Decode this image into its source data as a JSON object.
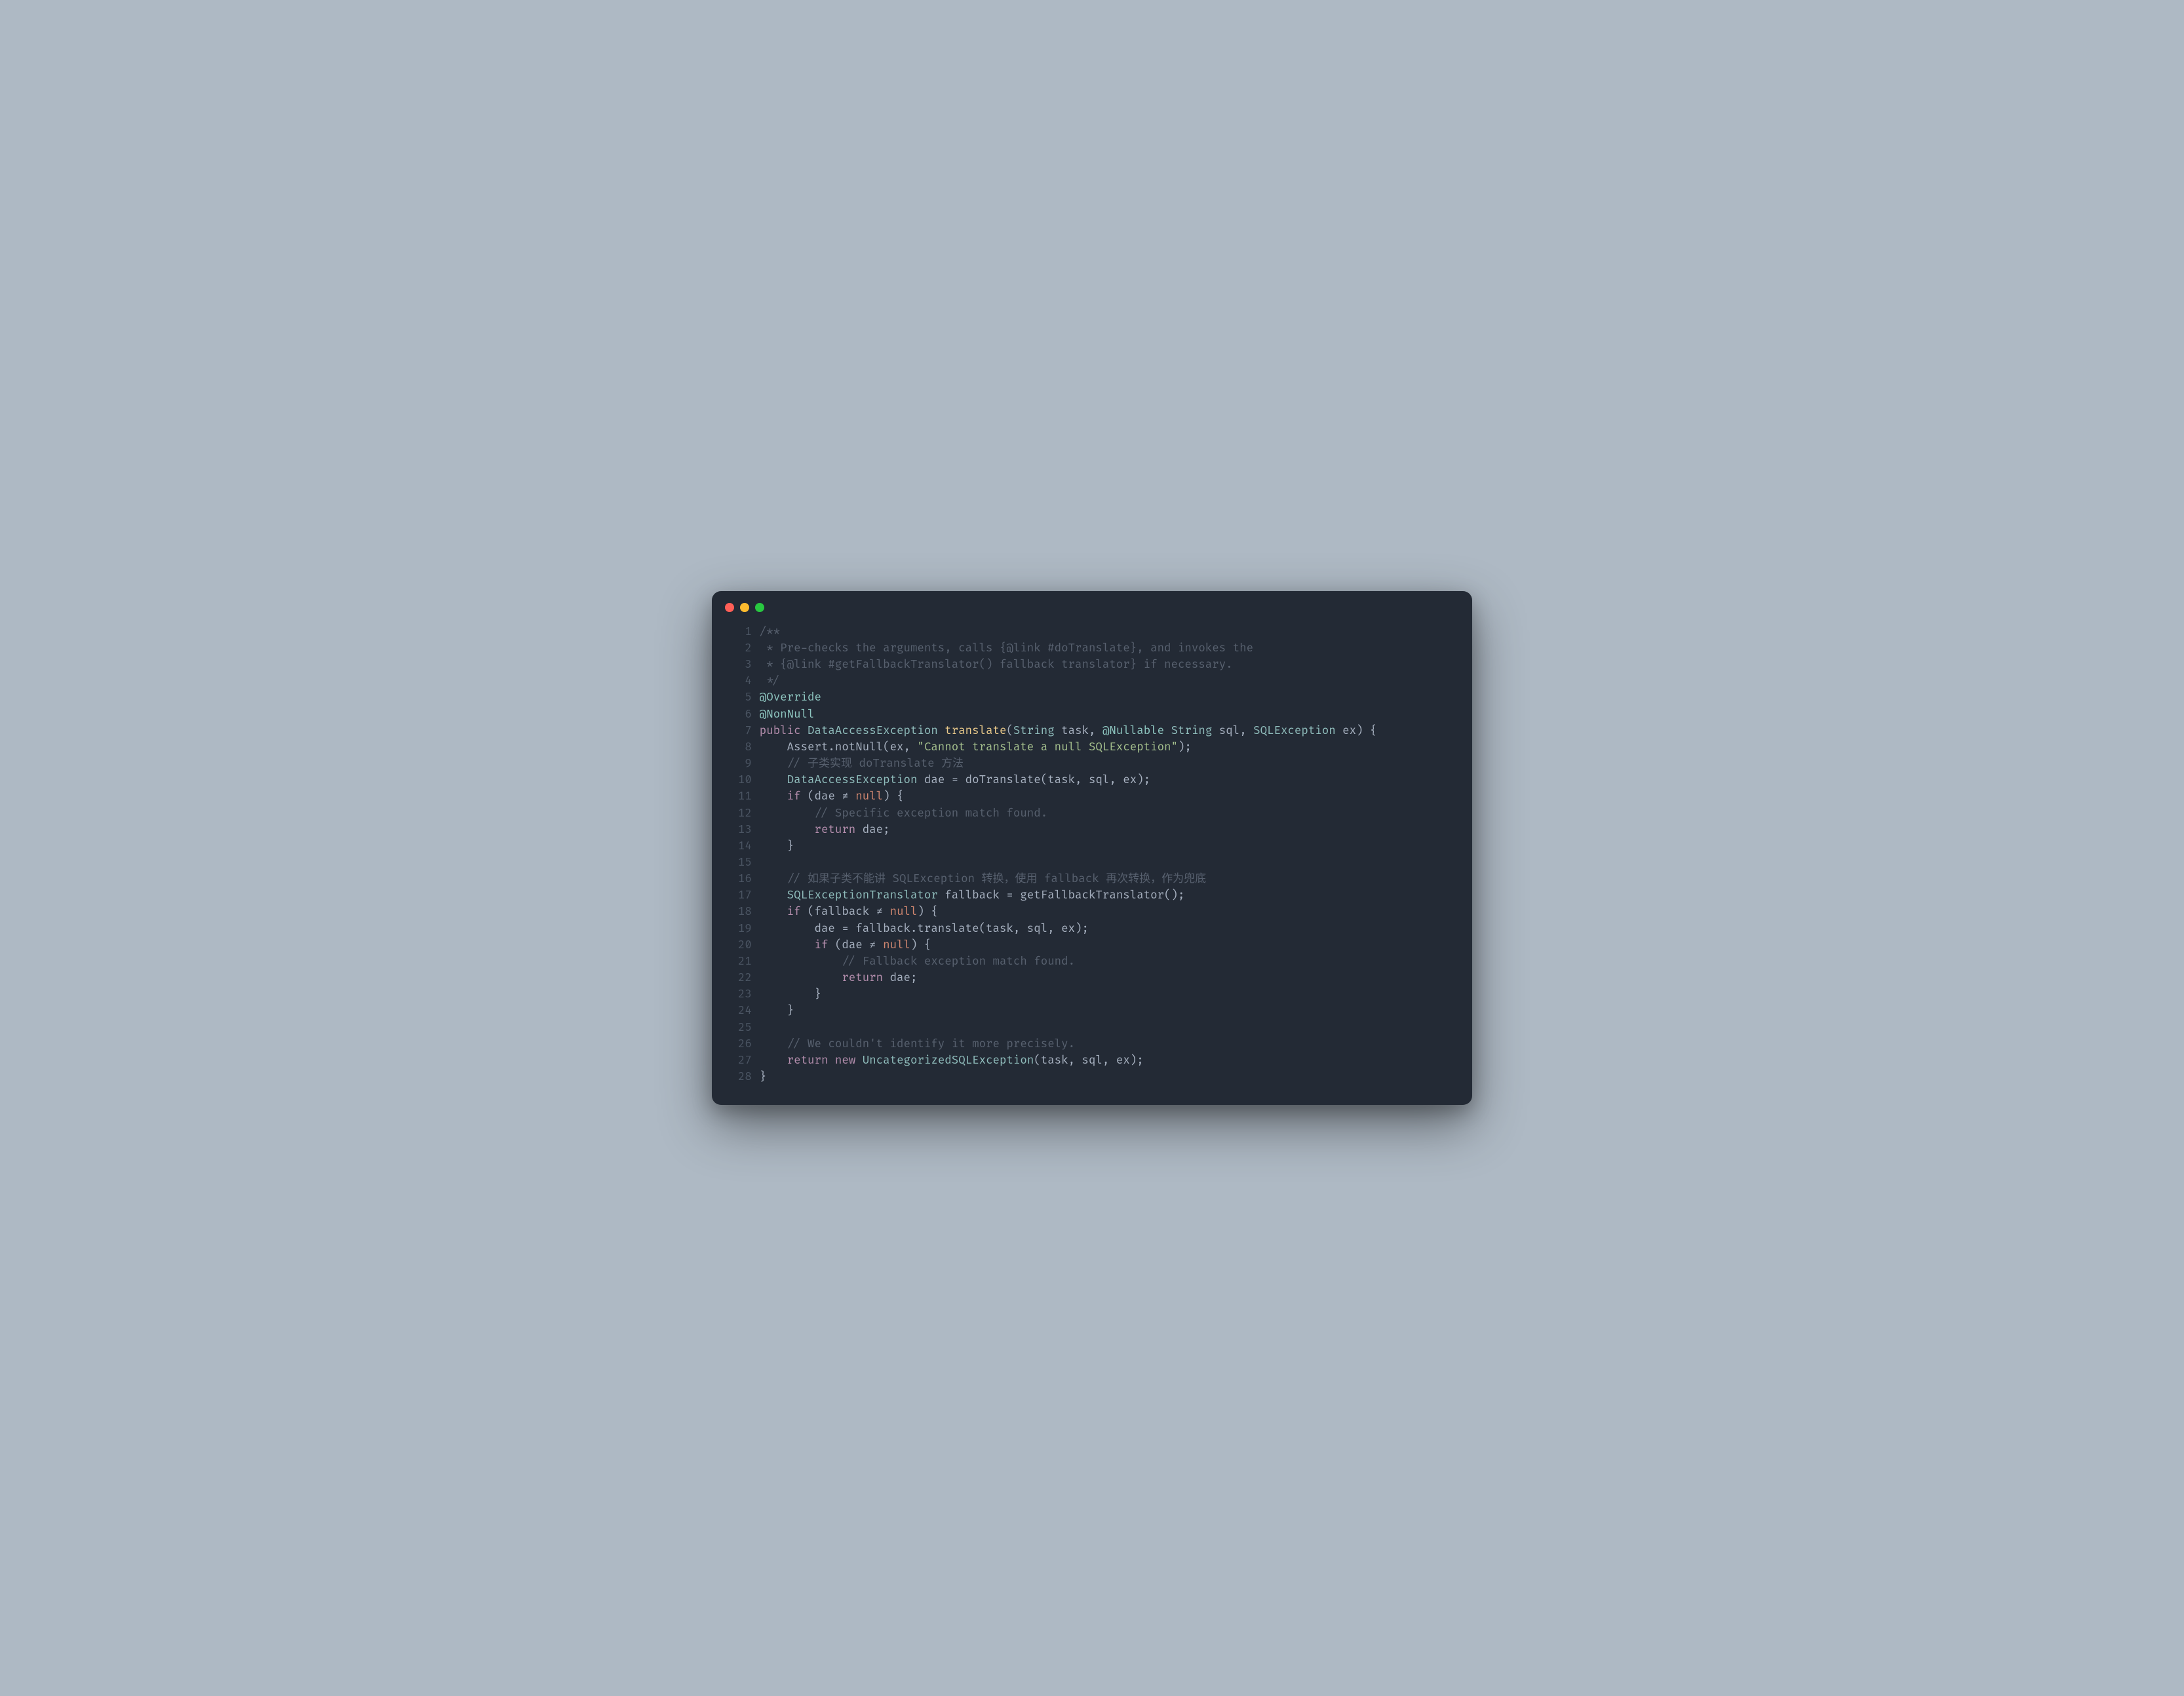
{
  "window": {
    "dots": [
      "red",
      "yellow",
      "green"
    ]
  },
  "code": {
    "lines": [
      {
        "n": 1,
        "t": [
          {
            "c": "c-comment",
            "s": "/**"
          }
        ]
      },
      {
        "n": 2,
        "t": [
          {
            "c": "c-comment",
            "s": " * Pre-checks the arguments, calls {@link #doTranslate}, and invokes the"
          }
        ]
      },
      {
        "n": 3,
        "t": [
          {
            "c": "c-comment",
            "s": " * {@link #getFallbackTranslator() fallback translator} if necessary."
          }
        ]
      },
      {
        "n": 4,
        "t": [
          {
            "c": "c-comment",
            "s": " */"
          }
        ]
      },
      {
        "n": 5,
        "t": [
          {
            "c": "c-anno",
            "s": "@Override"
          }
        ]
      },
      {
        "n": 6,
        "t": [
          {
            "c": "c-anno",
            "s": "@NonNull"
          }
        ]
      },
      {
        "n": 7,
        "t": [
          {
            "c": "c-kw",
            "s": "public"
          },
          {
            "c": "c-punc",
            "s": " "
          },
          {
            "c": "c-type",
            "s": "DataAccessException"
          },
          {
            "c": "c-punc",
            "s": " "
          },
          {
            "c": "c-fn",
            "s": "translate"
          },
          {
            "c": "c-punc",
            "s": "("
          },
          {
            "c": "c-type",
            "s": "String"
          },
          {
            "c": "c-punc",
            "s": " task, "
          },
          {
            "c": "c-anno",
            "s": "@Nullable"
          },
          {
            "c": "c-punc",
            "s": " "
          },
          {
            "c": "c-type",
            "s": "String"
          },
          {
            "c": "c-punc",
            "s": " sql, "
          },
          {
            "c": "c-type",
            "s": "SQLException"
          },
          {
            "c": "c-punc",
            "s": " ex) {"
          }
        ]
      },
      {
        "n": 8,
        "t": [
          {
            "c": "c-punc",
            "s": "    Assert.notNull(ex, "
          },
          {
            "c": "c-str",
            "s": "\"Cannot translate a null SQLException\""
          },
          {
            "c": "c-punc",
            "s": ");"
          }
        ]
      },
      {
        "n": 9,
        "t": [
          {
            "c": "c-punc",
            "s": "    "
          },
          {
            "c": "c-comment",
            "s": "// 子类实现 doTranslate 方法"
          }
        ]
      },
      {
        "n": 10,
        "t": [
          {
            "c": "c-punc",
            "s": "    "
          },
          {
            "c": "c-type",
            "s": "DataAccessException"
          },
          {
            "c": "c-punc",
            "s": " dae = doTranslate(task, sql, ex);"
          }
        ]
      },
      {
        "n": 11,
        "t": [
          {
            "c": "c-punc",
            "s": "    "
          },
          {
            "c": "c-kw",
            "s": "if"
          },
          {
            "c": "c-punc",
            "s": " (dae ≠ "
          },
          {
            "c": "c-null",
            "s": "null"
          },
          {
            "c": "c-punc",
            "s": ") {"
          }
        ]
      },
      {
        "n": 12,
        "t": [
          {
            "c": "c-punc",
            "s": "        "
          },
          {
            "c": "c-comment",
            "s": "// Specific exception match found."
          }
        ]
      },
      {
        "n": 13,
        "t": [
          {
            "c": "c-punc",
            "s": "        "
          },
          {
            "c": "c-kw",
            "s": "return"
          },
          {
            "c": "c-punc",
            "s": " dae;"
          }
        ]
      },
      {
        "n": 14,
        "t": [
          {
            "c": "c-punc",
            "s": "    }"
          }
        ]
      },
      {
        "n": 15,
        "t": [
          {
            "c": "c-punc",
            "s": ""
          }
        ]
      },
      {
        "n": 16,
        "t": [
          {
            "c": "c-punc",
            "s": "    "
          },
          {
            "c": "c-comment",
            "s": "// 如果子类不能讲 SQLException 转换，使用 fallback 再次转换，作为兜底"
          }
        ]
      },
      {
        "n": 17,
        "t": [
          {
            "c": "c-punc",
            "s": "    "
          },
          {
            "c": "c-type",
            "s": "SQLExceptionTranslator"
          },
          {
            "c": "c-punc",
            "s": " fallback = getFallbackTranslator();"
          }
        ]
      },
      {
        "n": 18,
        "t": [
          {
            "c": "c-punc",
            "s": "    "
          },
          {
            "c": "c-kw",
            "s": "if"
          },
          {
            "c": "c-punc",
            "s": " (fallback ≠ "
          },
          {
            "c": "c-null",
            "s": "null"
          },
          {
            "c": "c-punc",
            "s": ") {"
          }
        ]
      },
      {
        "n": 19,
        "t": [
          {
            "c": "c-punc",
            "s": "        dae = fallback.translate(task, sql, ex);"
          }
        ]
      },
      {
        "n": 20,
        "t": [
          {
            "c": "c-punc",
            "s": "        "
          },
          {
            "c": "c-kw",
            "s": "if"
          },
          {
            "c": "c-punc",
            "s": " (dae ≠ "
          },
          {
            "c": "c-null",
            "s": "null"
          },
          {
            "c": "c-punc",
            "s": ") {"
          }
        ]
      },
      {
        "n": 21,
        "t": [
          {
            "c": "c-punc",
            "s": "            "
          },
          {
            "c": "c-comment",
            "s": "// Fallback exception match found."
          }
        ]
      },
      {
        "n": 22,
        "t": [
          {
            "c": "c-punc",
            "s": "            "
          },
          {
            "c": "c-kw",
            "s": "return"
          },
          {
            "c": "c-punc",
            "s": " dae;"
          }
        ]
      },
      {
        "n": 23,
        "t": [
          {
            "c": "c-punc",
            "s": "        }"
          }
        ]
      },
      {
        "n": 24,
        "t": [
          {
            "c": "c-punc",
            "s": "    }"
          }
        ]
      },
      {
        "n": 25,
        "t": [
          {
            "c": "c-punc",
            "s": ""
          }
        ]
      },
      {
        "n": 26,
        "t": [
          {
            "c": "c-punc",
            "s": "    "
          },
          {
            "c": "c-comment",
            "s": "// We couldn't identify it more precisely."
          }
        ]
      },
      {
        "n": 27,
        "t": [
          {
            "c": "c-punc",
            "s": "    "
          },
          {
            "c": "c-kw",
            "s": "return"
          },
          {
            "c": "c-punc",
            "s": " "
          },
          {
            "c": "c-kw",
            "s": "new"
          },
          {
            "c": "c-punc",
            "s": " "
          },
          {
            "c": "c-type",
            "s": "UncategorizedSQLException"
          },
          {
            "c": "c-punc",
            "s": "(task, sql, ex);"
          }
        ]
      },
      {
        "n": 28,
        "t": [
          {
            "c": "c-punc",
            "s": "}"
          }
        ]
      }
    ]
  }
}
